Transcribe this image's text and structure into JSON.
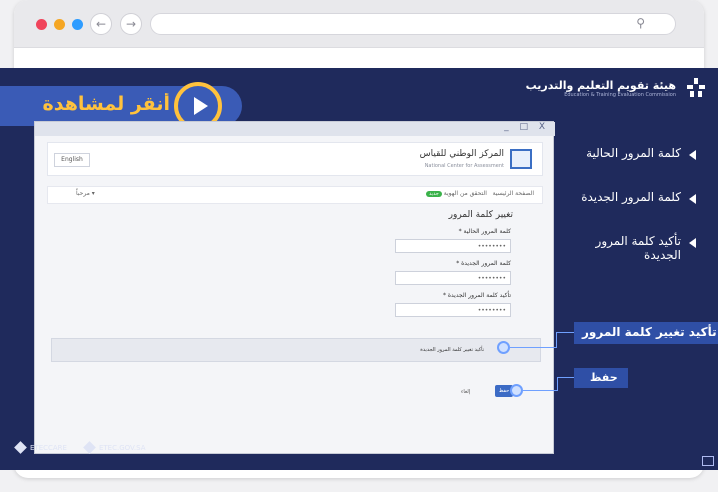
{
  "browser": {
    "dot_colors": [
      "#f0445b",
      "#f5a623",
      "#2e9cff"
    ],
    "back_icon": "←",
    "forward_icon": "→",
    "search_icon": "⚲"
  },
  "brand": {
    "name_ar": "هيئة تقويم التعليم والتدريب",
    "name_en": "Education & Training Evaluation Commission"
  },
  "cta": {
    "label": "أنقر لمشاهدة"
  },
  "sidebar": {
    "items": [
      {
        "label": "كلمة المرور الحالية"
      },
      {
        "label": "كلمة المرور الجديدة"
      },
      {
        "label": "تأكيد كلمة المرور الجديدة"
      }
    ]
  },
  "inner": {
    "english_button": "English",
    "center_name_ar": "المركز الوطني للقياس",
    "center_name_en": "National Center for Assessment",
    "nav_left": "مرحباً ▾",
    "nav_home": "الصفحة الرئيسية",
    "nav_verify": "التحقق من الهوية",
    "nav_badge": "جديد",
    "form_title": "تغيير كلمة المرور",
    "fields": [
      {
        "label": "كلمة المرور الحالية *",
        "value": "••••••••"
      },
      {
        "label": "كلمة المرور الجديدة *",
        "value": "••••••••"
      },
      {
        "label": "تأكيد كلمة المرور الجديدة *",
        "value": "••••••••"
      }
    ],
    "confirm_label": "تأكيد تغيير كلمة المرور الجديدة",
    "save_label": "حفظ",
    "cancel_label": "إلغاء"
  },
  "callouts": {
    "confirm": "تأكيد تغيير كلمة المرور",
    "save": "حفظ"
  },
  "footer": {
    "items": [
      "ETECCARE",
      "ETEC.GOV.SA"
    ]
  },
  "window_controls": "_ □ X"
}
